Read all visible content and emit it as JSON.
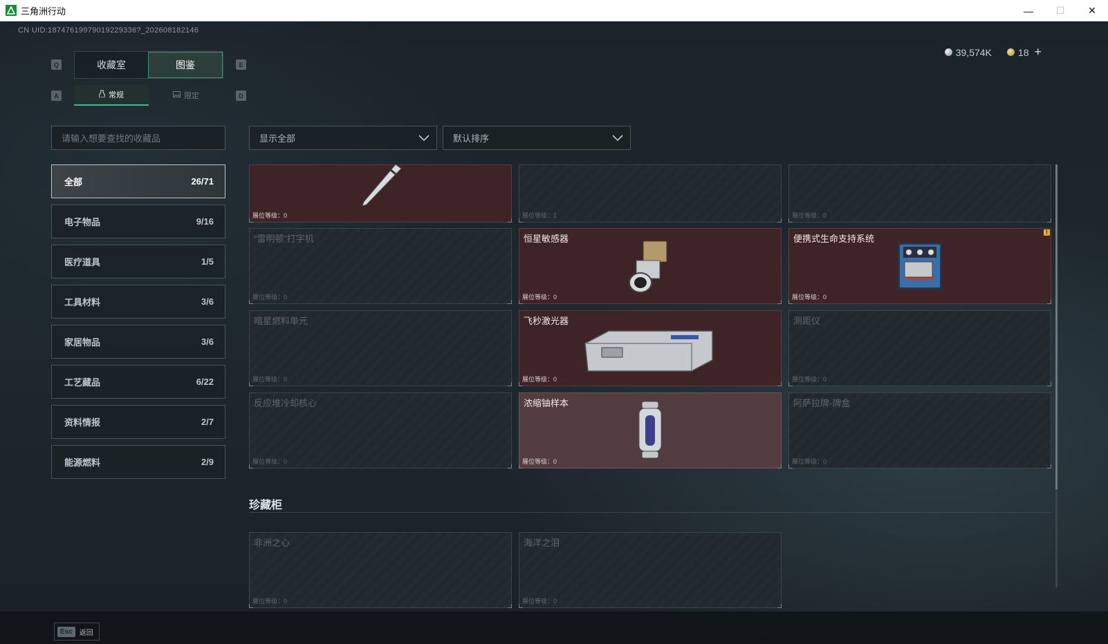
{
  "window": {
    "title": "三角洲行动",
    "minimize": "—",
    "maximize": "☐",
    "close": "✕"
  },
  "uid": "CN UID:18747619979019229336?_202608182146",
  "currency": {
    "coins": "39,574K",
    "tickets": "18",
    "add": "+"
  },
  "hotkeys": {
    "prev_tab": "Q",
    "next_tab": "E",
    "prev_sub": "A",
    "next_sub": "D"
  },
  "main_tabs": [
    {
      "label": "收藏室",
      "active": false
    },
    {
      "label": "图鉴",
      "active": true
    }
  ],
  "sub_tabs": [
    {
      "label": "常规",
      "active": true
    },
    {
      "label": "限定",
      "active": false
    }
  ],
  "search": {
    "placeholder": "请输入想要查找的收藏品"
  },
  "filters": {
    "show": "显示全部",
    "sort": "默认排序"
  },
  "categories": [
    {
      "label": "全部",
      "count": "26/71",
      "active": true
    },
    {
      "label": "电子物品",
      "count": "9/16"
    },
    {
      "label": "医疗道具",
      "count": "1/5"
    },
    {
      "label": "工具材料",
      "count": "3/6"
    },
    {
      "label": "家居物品",
      "count": "3/6"
    },
    {
      "label": "工艺藏品",
      "count": "6/22"
    },
    {
      "label": "资料情报",
      "count": "2/7"
    },
    {
      "label": "能源燃料",
      "count": "2/9"
    }
  ],
  "cards": [
    {
      "name": "",
      "level": "展位等级：0",
      "owned": true
    },
    {
      "name": "",
      "level": "展位等级：1",
      "owned": false
    },
    {
      "name": "",
      "level": "展位等级：0",
      "owned": false
    },
    {
      "name": "“雷明顿”打字机",
      "level": "展位等级：0",
      "owned": false
    },
    {
      "name": "恒星敏感器",
      "level": "展位等级：0",
      "owned": true
    },
    {
      "name": "便携式生命支持系统",
      "level": "展位等级：0",
      "owned": true,
      "badge": "!"
    },
    {
      "name": "暗星燃料单元",
      "level": "展位等级：0",
      "owned": false
    },
    {
      "name": "飞秒激光器",
      "level": "展位等级：0",
      "owned": true
    },
    {
      "name": "测距仪",
      "level": "展位等级：0",
      "owned": false
    },
    {
      "name": "反应堆冷却核心",
      "level": "展位等级：0",
      "owned": false
    },
    {
      "name": "浓缩铀样本",
      "level": "展位等级：0",
      "owned": true
    },
    {
      "name": "阿萨拉牌-牌盒",
      "level": "展位等级：0",
      "owned": false
    }
  ],
  "treasure_section": {
    "title": "珍藏柜",
    "cards": [
      {
        "name": "非洲之心",
        "level": "展位等级：0"
      },
      {
        "name": "海洋之泪",
        "level": "展位等级：0"
      }
    ]
  },
  "footer": {
    "esc_key": "Esc",
    "back_label": "返回"
  }
}
